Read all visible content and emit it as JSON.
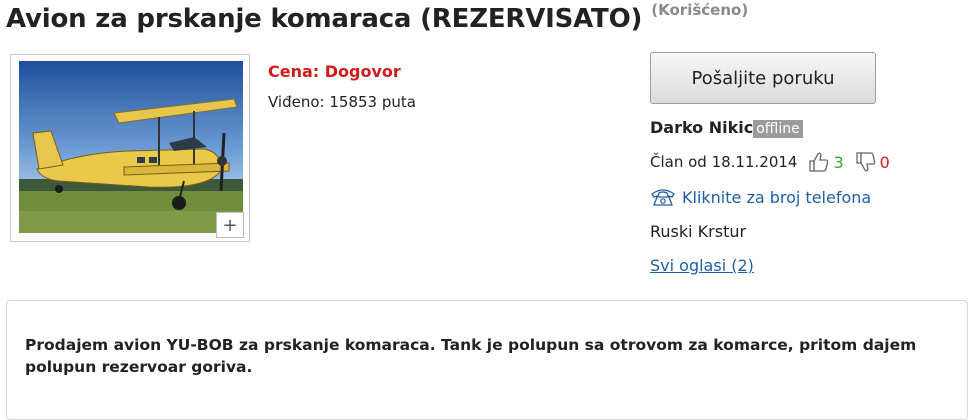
{
  "listing": {
    "title": "Avion za prskanje komaraca (REZERVISATO)",
    "condition": "(Korišćeno)",
    "price": "Cena: Dogovor",
    "views": "Viđeno: 15853 puta",
    "zoom_label": "+"
  },
  "seller": {
    "send_message_label": "Pošaljite poruku",
    "name": "Darko Nikic",
    "status": "offline",
    "member_since": "Član od 18.11.2014",
    "likes": "3",
    "dislikes": "0",
    "phone_link": "Kliknite za broj telefona",
    "location": "Ruski Krstur",
    "all_ads": "Svi oglasi (2)"
  },
  "description": {
    "text": "Prodajem avion YU-BOB za prskanje komaraca. Tank je polupun sa otrovom za komarce, pritom dajem polupun rezervoar goriva."
  },
  "colors": {
    "price_red": "#d11a1a",
    "link_blue": "#1f5fa8",
    "like_green": "#3aa62f",
    "status_gray": "#9b9b9b"
  },
  "icons": [
    "thumbs-up-icon",
    "thumbs-down-icon",
    "phone-icon",
    "zoom-plus-icon"
  ]
}
